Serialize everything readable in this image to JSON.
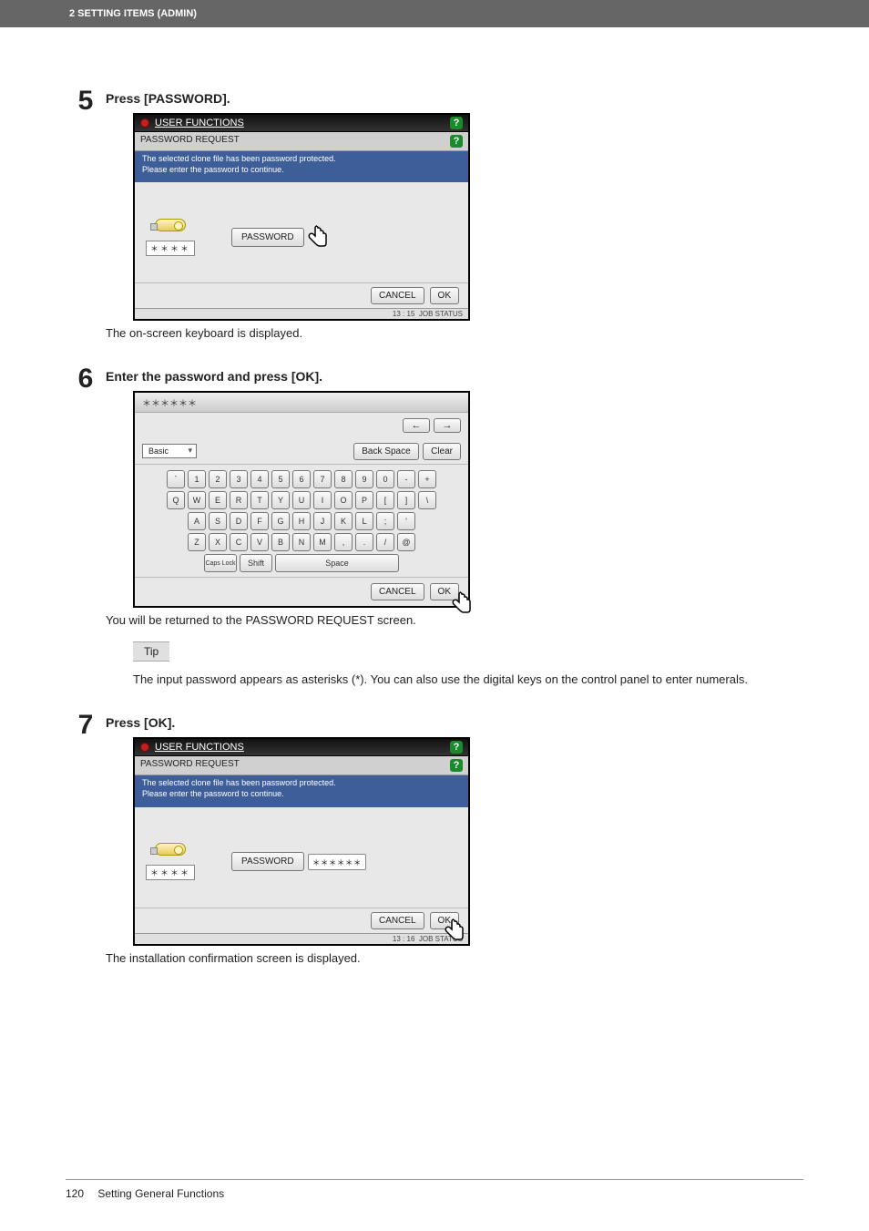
{
  "header": {
    "text": "2 SETTING ITEMS (ADMIN)"
  },
  "steps": {
    "s5": {
      "num": "5",
      "title": "Press [PASSWORD].",
      "after": "The on-screen keyboard is displayed.",
      "lcd": {
        "uf_title": "USER FUNCTIONS",
        "sub_title": "PASSWORD REQUEST",
        "msg1": "The selected clone file has been password protected.",
        "msg2": "Please enter the password to continue.",
        "usb_label": "＊＊＊＊",
        "password_btn": "PASSWORD",
        "cancel": "CANCEL",
        "ok": "OK",
        "time": "13 : 15",
        "job": "JOB STATUS"
      }
    },
    "s6": {
      "num": "6",
      "title": "Enter the password and press [OK].",
      "after": "You will be returned to the PASSWORD REQUEST screen.",
      "kbd": {
        "input_value": "＊＊＊＊＊＊",
        "mode": "Basic",
        "backspace": "Back Space",
        "clear": "Clear",
        "arrow_left": "←",
        "arrow_right": "→",
        "row1": [
          "`",
          "1",
          "2",
          "3",
          "4",
          "5",
          "6",
          "7",
          "8",
          "9",
          "0",
          "-",
          "+"
        ],
        "row2": [
          "Q",
          "W",
          "E",
          "R",
          "T",
          "Y",
          "U",
          "I",
          "O",
          "P",
          "[",
          "]",
          "\\"
        ],
        "row3": [
          "A",
          "S",
          "D",
          "F",
          "G",
          "H",
          "J",
          "K",
          "L",
          ";",
          "'"
        ],
        "row4": [
          "Z",
          "X",
          "C",
          "V",
          "B",
          "N",
          "M",
          ",",
          ".",
          "/",
          "@"
        ],
        "caps": "Caps Lock",
        "shift": "Shift",
        "space": "Space",
        "cancel": "CANCEL",
        "ok": "OK"
      },
      "tip_label": "Tip",
      "tip_text": "The input password appears as asterisks (*). You can also use the digital keys on the control panel to enter numerals."
    },
    "s7": {
      "num": "7",
      "title": "Press [OK].",
      "after": "The installation confirmation screen is displayed.",
      "lcd": {
        "uf_title": "USER FUNCTIONS",
        "sub_title": "PASSWORD REQUEST",
        "msg1": "The selected clone file has been password protected.",
        "msg2": "Please enter the password to continue.",
        "usb_label": "＊＊＊＊",
        "password_btn": "PASSWORD",
        "password_value": "＊＊＊＊＊＊",
        "cancel": "CANCEL",
        "ok": "OK",
        "time": "13 : 16",
        "job": "JOB STATUS"
      }
    }
  },
  "footer": {
    "page": "120",
    "section": "Setting General Functions"
  }
}
